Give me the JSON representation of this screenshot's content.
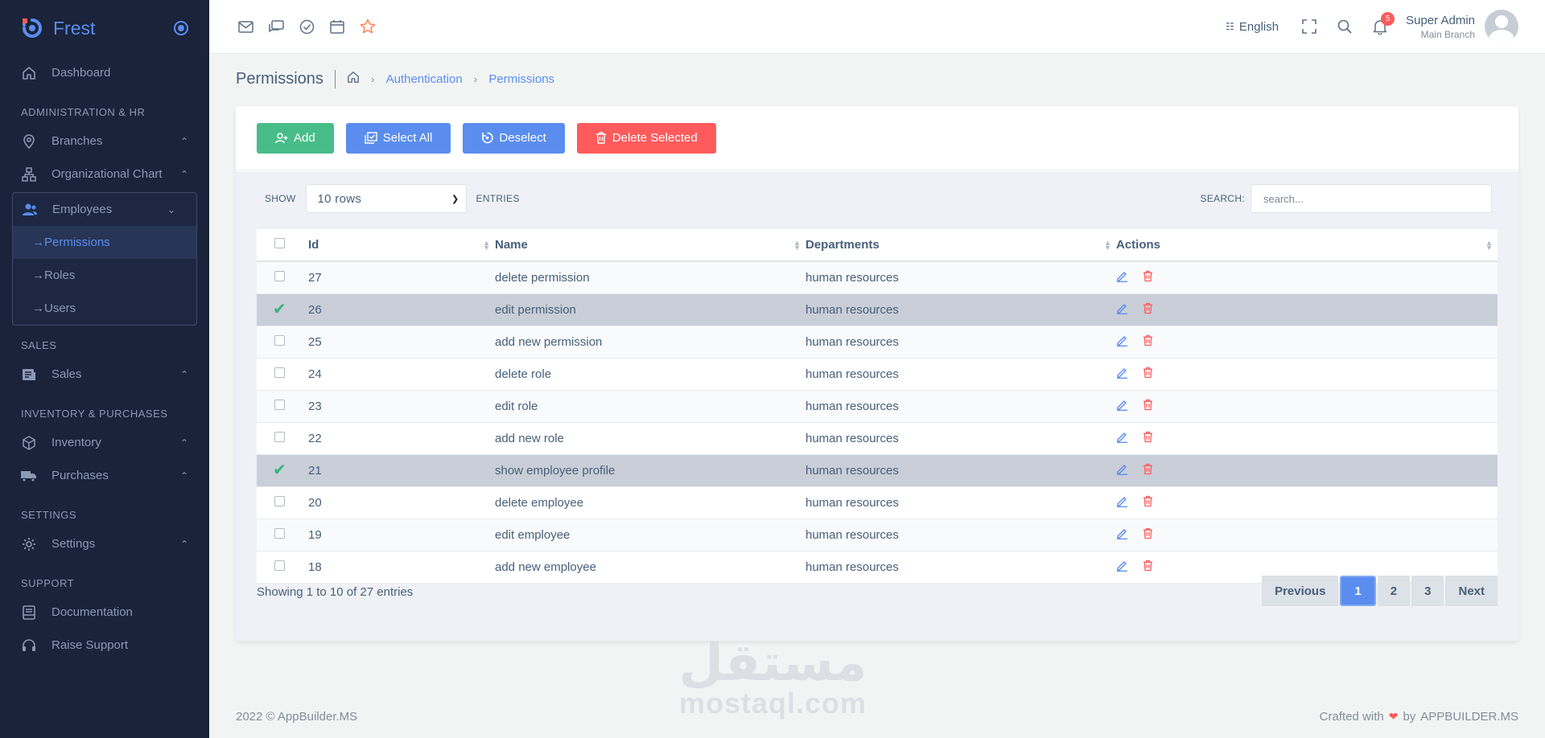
{
  "brand": {
    "name": "Frest"
  },
  "sidebar": {
    "dashboard": "Dashboard",
    "sections": {
      "admin": "ADMINISTRATION & HR",
      "sales": "SALES",
      "inventory": "INVENTORY & PURCHASES",
      "settings": "SETTINGS",
      "support": "SUPPORT"
    },
    "branches": "Branches",
    "org_chart": "Organizational Chart",
    "employees": "Employees",
    "employee_subs": [
      "Permissions",
      "Roles",
      "Users"
    ],
    "sales": "Sales",
    "inventory": "Inventory",
    "purchases": "Purchases",
    "settings": "Settings",
    "documentation": "Documentation",
    "raise_support": "Raise Support",
    "active_sub": "Permissions"
  },
  "header": {
    "language": "English",
    "notifications_count": "5",
    "user_name": "Super Admin",
    "user_branch": "Main Branch"
  },
  "breadcrumb": {
    "title": "Permissions",
    "items": [
      "Authentication",
      "Permissions"
    ]
  },
  "toolbar": {
    "add": "Add",
    "select_all": "Select All",
    "deselect": "Deselect",
    "delete_selected": "Delete Selected"
  },
  "table_controls": {
    "show_label": "SHOW",
    "rows_value": "10 rows",
    "entries_label": "ENTRIES",
    "search_label": "SEARCH:",
    "search_placeholder": "search..."
  },
  "table": {
    "columns": [
      "Id",
      "Name",
      "Departments",
      "Actions"
    ],
    "rows": [
      {
        "id": "27",
        "name": "delete permission",
        "department": "human resources",
        "selected": false
      },
      {
        "id": "26",
        "name": "edit permission",
        "department": "human resources",
        "selected": true
      },
      {
        "id": "25",
        "name": "add new permission",
        "department": "human resources",
        "selected": false
      },
      {
        "id": "24",
        "name": "delete role",
        "department": "human resources",
        "selected": false
      },
      {
        "id": "23",
        "name": "edit role",
        "department": "human resources",
        "selected": false
      },
      {
        "id": "22",
        "name": "add new role",
        "department": "human resources",
        "selected": false
      },
      {
        "id": "21",
        "name": "show employee profile",
        "department": "human resources",
        "selected": true
      },
      {
        "id": "20",
        "name": "delete employee",
        "department": "human resources",
        "selected": false
      },
      {
        "id": "19",
        "name": "edit employee",
        "department": "human resources",
        "selected": false
      },
      {
        "id": "18",
        "name": "add new employee",
        "department": "human resources",
        "selected": false
      }
    ]
  },
  "footer_info": "Showing 1 to 10 of 27 entries",
  "pagination": {
    "previous": "Previous",
    "pages": [
      "1",
      "2",
      "3"
    ],
    "active": "1",
    "next": "Next"
  },
  "footer": {
    "copyright": "2022 © AppBuilder.MS",
    "crafted": "Crafted with",
    "by": "by",
    "company": "APPBUILDER.MS"
  },
  "watermark": {
    "arabic": "مستقل",
    "latin": "mostaql.com"
  },
  "colors": {
    "primary": "#5a8dee",
    "success": "#48bd8a",
    "danger": "#ff5b5c",
    "sidebar": "#1a233a"
  }
}
